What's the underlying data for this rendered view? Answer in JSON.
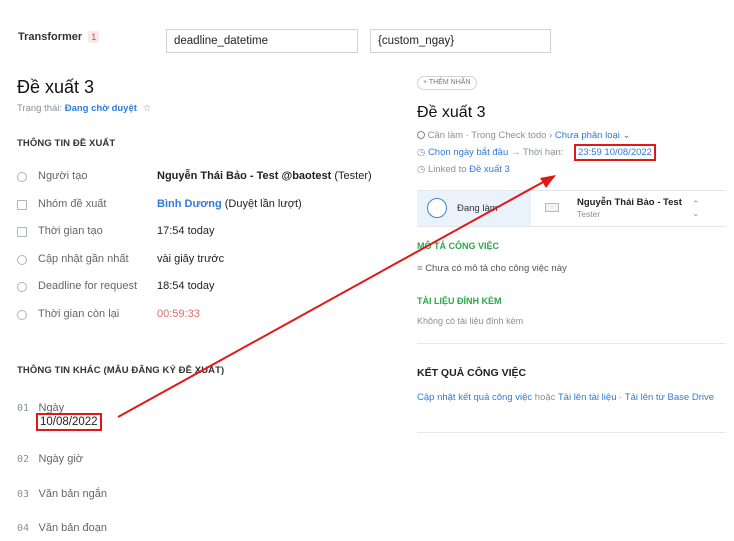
{
  "transformer": {
    "label": "Transformer",
    "badge": "1",
    "field1_value": "deadline_datetime",
    "field2_value": "{custom_ngay}"
  },
  "left": {
    "title": "Đề xuất 3",
    "status_label": "Trạng thái:",
    "status_value": "Đang chờ duyệt",
    "info_heading": "THÔNG TIN ĐỀ XUẤT",
    "rows": [
      {
        "label": "Người tạo",
        "value_bold": "Nguyễn Thái Bảo - Test @baotest",
        "value_rest": " (Tester)"
      },
      {
        "label": "Nhóm đề xuất",
        "value_link": "Bình Dương",
        "value_rest": " (Duyệt lần lượt)"
      },
      {
        "label": "Thời gian tạo",
        "value": "17:54 today"
      },
      {
        "label": "Cập nhật gần nhất",
        "value": "vài giây trước"
      },
      {
        "label": "Deadline for request",
        "value": "18:54 today"
      },
      {
        "label": "Thời gian còn lại",
        "value": "00:59:33"
      }
    ],
    "other_heading": "THÔNG TIN KHÁC (MẪU ĐĂNG KÝ ĐỀ XUẤT)",
    "fields": [
      {
        "num": "01",
        "label": "Ngày",
        "value": "10/08/2022"
      },
      {
        "num": "02",
        "label": "Ngày giờ"
      },
      {
        "num": "03",
        "label": "Văn bản ngắn"
      },
      {
        "num": "04",
        "label": "Văn bản đoạn"
      }
    ]
  },
  "right": {
    "add_tag": "+ THÊM NHÃN",
    "title": "Đề xuất 3",
    "meta1_a": "Cần làm · Trong Check todo ›",
    "meta1_link": "Chưa phân loại ⌄",
    "meta2_link": "Chọn ngày bắt đầu",
    "meta2_arrow": "→",
    "meta2_label": "Thời hạn:",
    "meta2_deadline": "23:59 10/08/2022",
    "meta3_label": "Linked to",
    "meta3_link": "Đề xuất 3",
    "status_card": "Đang làm",
    "assignee_name": "Nguyễn Thái Bảo - Test",
    "assignee_role": "Tester",
    "desc_heading": "MÔ TẢ CÔNG VIỆC",
    "desc_empty": "Chưa có mô tả cho công việc này",
    "attach_heading": "TÀI LIỆU ĐÍNH KÈM",
    "attach_empty": "Không có tài liệu đính kèm",
    "result_heading": "KẾT QUẢ CÔNG VIỆC",
    "result_link1": "Cập nhật kết quả công việc",
    "result_or": " hoặc ",
    "result_link2": "Tải lên tài liệu",
    "result_sep": " · ",
    "result_link3": "Tải lên từ Base Drive"
  },
  "annotation": {
    "arrow_color": "#e01818"
  }
}
